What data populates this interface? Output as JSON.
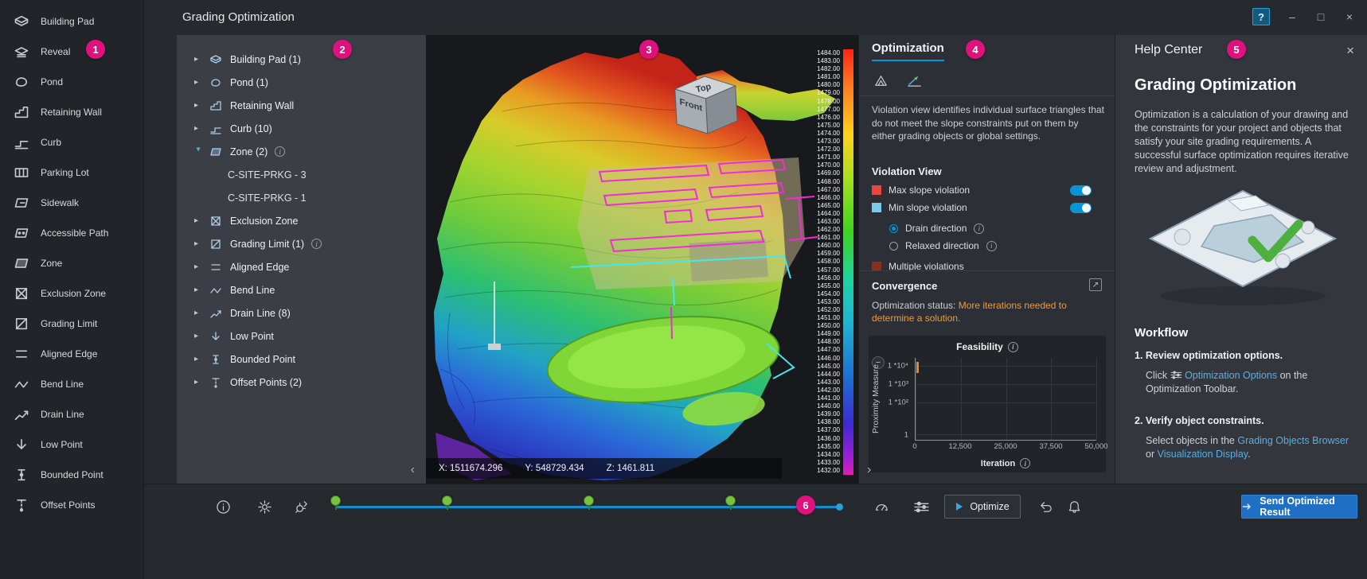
{
  "window": {
    "title": "Grading Optimization",
    "controls": {
      "help": "?",
      "minimize": "–",
      "maximize": "□",
      "close": "×"
    }
  },
  "badges": {
    "palette": "1",
    "browser": "2",
    "viewport": "3",
    "optimization": "4",
    "help": "5",
    "toolbar": "6"
  },
  "palette": {
    "items": [
      {
        "id": "building-pad",
        "label": "Building Pad"
      },
      {
        "id": "reveal",
        "label": "Reveal"
      },
      {
        "id": "pond",
        "label": "Pond"
      },
      {
        "id": "retaining-wall",
        "label": "Retaining Wall"
      },
      {
        "id": "curb",
        "label": "Curb"
      },
      {
        "id": "parking-lot",
        "label": "Parking Lot"
      },
      {
        "id": "sidewalk",
        "label": "Sidewalk"
      },
      {
        "id": "accessible-path",
        "label": "Accessible Path"
      },
      {
        "id": "zone",
        "label": "Zone"
      },
      {
        "id": "exclusion-zone",
        "label": "Exclusion Zone"
      },
      {
        "id": "grading-limit",
        "label": "Grading Limit"
      },
      {
        "id": "aligned-edge",
        "label": "Aligned Edge"
      },
      {
        "id": "bend-line",
        "label": "Bend Line"
      },
      {
        "id": "drain-line",
        "label": "Drain Line"
      },
      {
        "id": "low-point",
        "label": "Low Point"
      },
      {
        "id": "bounded-point",
        "label": "Bounded Point"
      },
      {
        "id": "offset-points",
        "label": "Offset Points"
      }
    ]
  },
  "browser": {
    "items": [
      {
        "icon": "building-pad",
        "label": "Building Pad (1)",
        "expand": "collapsed"
      },
      {
        "icon": "pond",
        "label": "Pond (1)",
        "expand": "collapsed"
      },
      {
        "icon": "retaining-wall",
        "label": "Retaining Wall",
        "expand": "collapsed"
      },
      {
        "icon": "curb",
        "label": "Curb (10)",
        "expand": "collapsed"
      },
      {
        "icon": "zone",
        "label": "Zone (2)",
        "expand": "expanded",
        "info": true
      },
      {
        "label": "C-SITE-PRKG - 3",
        "child": true
      },
      {
        "label": "C-SITE-PRKG - 1",
        "child": true
      },
      {
        "icon": "exclusion-zone",
        "label": "Exclusion Zone",
        "expand": "collapsed"
      },
      {
        "icon": "grading-limit",
        "label": "Grading Limit (1)",
        "expand": "collapsed",
        "info": true
      },
      {
        "icon": "aligned-edge",
        "label": "Aligned Edge",
        "expand": "collapsed"
      },
      {
        "icon": "bend-line",
        "label": "Bend Line",
        "expand": "collapsed"
      },
      {
        "icon": "drain-line",
        "label": "Drain Line (8)",
        "expand": "collapsed"
      },
      {
        "icon": "low-point",
        "label": "Low Point",
        "expand": "collapsed"
      },
      {
        "icon": "bounded-point",
        "label": "Bounded Point",
        "expand": "collapsed"
      },
      {
        "icon": "offset-points",
        "label": "Offset Points (2)",
        "expand": "collapsed"
      }
    ]
  },
  "viewport": {
    "viewcube": {
      "top": "Top",
      "front": "Front"
    },
    "coords": {
      "x": "X: 1511674.296",
      "y": "Y: 548729.434",
      "z": "Z: 1461.811"
    },
    "legend_values": [
      "1484.00",
      "1483.00",
      "1482.00",
      "1481.00",
      "1480.00",
      "1479.00",
      "1478.00",
      "1477.00",
      "1476.00",
      "1475.00",
      "1474.00",
      "1473.00",
      "1472.00",
      "1471.00",
      "1470.00",
      "1469.00",
      "1468.00",
      "1467.00",
      "1466.00",
      "1465.00",
      "1464.00",
      "1463.00",
      "1462.00",
      "1461.00",
      "1460.00",
      "1459.00",
      "1458.00",
      "1457.00",
      "1456.00",
      "1455.00",
      "1454.00",
      "1453.00",
      "1452.00",
      "1451.00",
      "1450.00",
      "1449.00",
      "1448.00",
      "1447.00",
      "1446.00",
      "1445.00",
      "1444.00",
      "1443.00",
      "1442.00",
      "1441.00",
      "1440.00",
      "1439.00",
      "1438.00",
      "1437.00",
      "1436.00",
      "1435.00",
      "1434.00",
      "1433.00",
      "1432.00"
    ]
  },
  "optimization": {
    "tab": "Optimization",
    "description": "Violation view identifies individual surface triangles that do not meet the slope constraints put on them by either grading objects or global settings.",
    "violation_view": {
      "title": "Violation View",
      "max_slope": {
        "label": "Max slope violation",
        "color": "#e8483f",
        "enabled": true
      },
      "min_slope": {
        "label": "Min slope violation",
        "color": "#7ec8ea",
        "enabled": true
      },
      "drain_direction": {
        "label": "Drain direction",
        "selected": true
      },
      "relaxed_direction": {
        "label": "Relaxed direction",
        "selected": false
      },
      "multiple": {
        "label": "Multiple violations",
        "color": "#8a2e20"
      }
    },
    "convergence": {
      "title": "Convergence",
      "status_label": "Optimization status: ",
      "status_value": "More iterations needed to determine a solution."
    },
    "chart": {
      "title": "Feasibility",
      "ylabel": "Proximity Measure",
      "xlabel": "Iteration",
      "yticks": [
        "1 *10⁴",
        "1 *10³",
        "1 *10²",
        "1"
      ],
      "xticks": [
        "0",
        "12,500",
        "25,000",
        "37,500",
        "50,000"
      ]
    }
  },
  "chart_data": {
    "type": "line",
    "title": "Feasibility",
    "xlabel": "Iteration",
    "ylabel": "Proximity Measure",
    "xlim": [
      0,
      50000
    ],
    "yscale": "log",
    "yticks": [
      1,
      100,
      1000,
      10000
    ],
    "grid": true,
    "series": [
      {
        "name": "Feasibility",
        "color": "#e8882a",
        "points": [
          [
            0,
            14000
          ],
          [
            600,
            9000
          ]
        ]
      }
    ]
  },
  "help": {
    "title": "Help Center",
    "heading": "Grading Optimization",
    "intro": "Optimization is a calculation of your drawing and the constraints for your project and objects that satisfy your site grading requirements. A successful surface optimization requires iterative review and adjustment.",
    "workflow_title": "Workflow",
    "step1": {
      "title": "1. Review optimization options.",
      "pre": "Click",
      "link": "Optimization Options",
      "post": "on the Optimization Toolbar."
    },
    "step2": {
      "title": "2. Verify object constraints.",
      "pre": "Select objects in the",
      "link1": "Grading Objects Browser",
      "mid": "or",
      "link2": "Visualization Display",
      "post": "."
    }
  },
  "toolbar": {
    "optimize": "Optimize",
    "send": "Send Optimized Result"
  }
}
